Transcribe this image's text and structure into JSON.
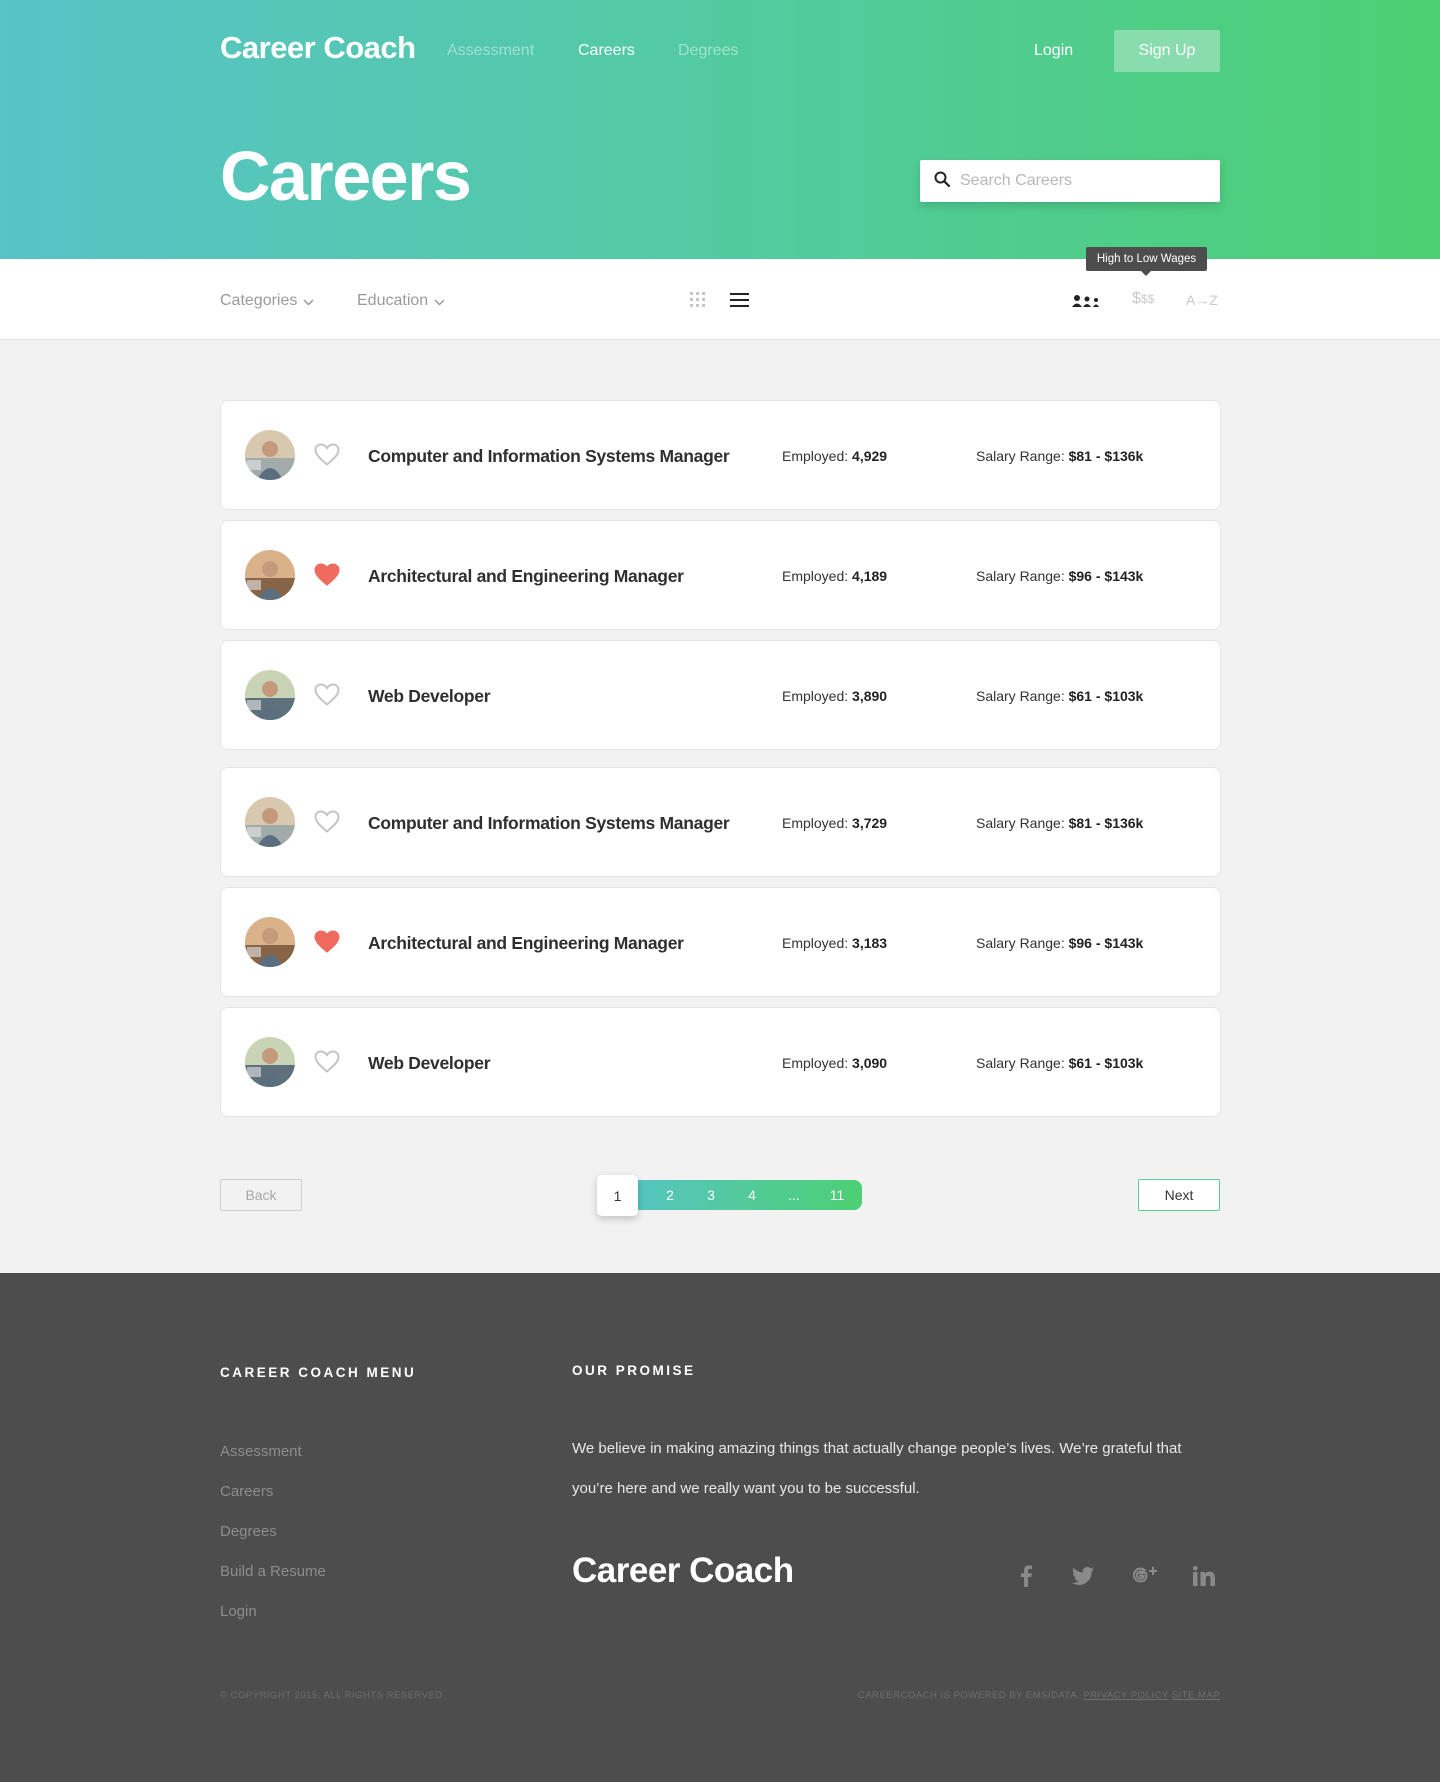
{
  "header": {
    "logo": "Career Coach",
    "nav": [
      {
        "label": "Assessment"
      },
      {
        "label": "Careers"
      },
      {
        "label": "Degrees"
      }
    ],
    "login": "Login",
    "signup": "Sign Up",
    "page_title": "Careers",
    "search_placeholder": "Search Careers"
  },
  "filters": {
    "categories": "Categories",
    "education": "Education",
    "sort_tooltip": "High to Low Wages",
    "sort_wage_label": "$",
    "sort_wage_small": "$$",
    "sort_az_label": "A→Z",
    "icons": {
      "grid_view": "grid-icon",
      "list_view": "list-icon",
      "sort_employed": "people-icon"
    }
  },
  "careers": [
    {
      "title": "Computer and Information Systems Manager",
      "employed_label": "Employed:",
      "employed": "4,929",
      "salary_label": "Salary Range:",
      "salary": "$81 - $136k",
      "favorite": false
    },
    {
      "title": "Architectural and Engineering Manager",
      "employed_label": "Employed:",
      "employed": "4,189",
      "salary_label": "Salary Range:",
      "salary": "$96 - $143k",
      "favorite": true
    },
    {
      "title": "Web Developer",
      "employed_label": "Employed:",
      "employed": "3,890",
      "salary_label": "Salary Range:",
      "salary": "$61 - $103k",
      "favorite": false
    },
    {
      "title": "Computer and Information Systems Manager",
      "employed_label": "Employed:",
      "employed": "3,729",
      "salary_label": "Salary Range:",
      "salary": "$81 - $136k",
      "favorite": false
    },
    {
      "title": "Architectural and Engineering Manager",
      "employed_label": "Employed:",
      "employed": "3,183",
      "salary_label": "Salary Range:",
      "salary": "$96 - $143k",
      "favorite": true
    },
    {
      "title": "Web Developer",
      "employed_label": "Employed:",
      "employed": "3,090",
      "salary_label": "Salary Range:",
      "salary": "$61 - $103k",
      "favorite": false
    }
  ],
  "pagination": {
    "back": "Back",
    "next": "Next",
    "pages": [
      "1",
      "2",
      "3",
      "4",
      "...",
      "11"
    ],
    "current": "1"
  },
  "footer": {
    "menu_heading": "CAREER COACH MENU",
    "menu": [
      "Assessment",
      "Careers",
      "Degrees",
      "Build a Resume",
      "Login"
    ],
    "promise_heading": "OUR PROMISE",
    "promise_line1": "We believe in making amazing things that actually change people’s lives.  We’re grateful that",
    "promise_line2": "you’re here and we really want you to be successful.",
    "logo": "Career Coach",
    "social": [
      "facebook-icon",
      "twitter-icon",
      "google-plus-icon",
      "linkedin-icon"
    ],
    "copyright": "© COPYRIGHT 2015. ALL RIGHTS RESERVED",
    "powered": "CAREERCOACH IS POWERED BY EMSIDATA.",
    "privacy": "PRIVACY POLICY",
    "sitemap": "SITE MAP"
  },
  "colors": {
    "gradient_start": "#58c3c8",
    "gradient_end": "#4cd073",
    "heart_active": "#ef6b5f",
    "heart_inactive": "#c4c4c4",
    "footer_bg": "#4d4d4d"
  }
}
